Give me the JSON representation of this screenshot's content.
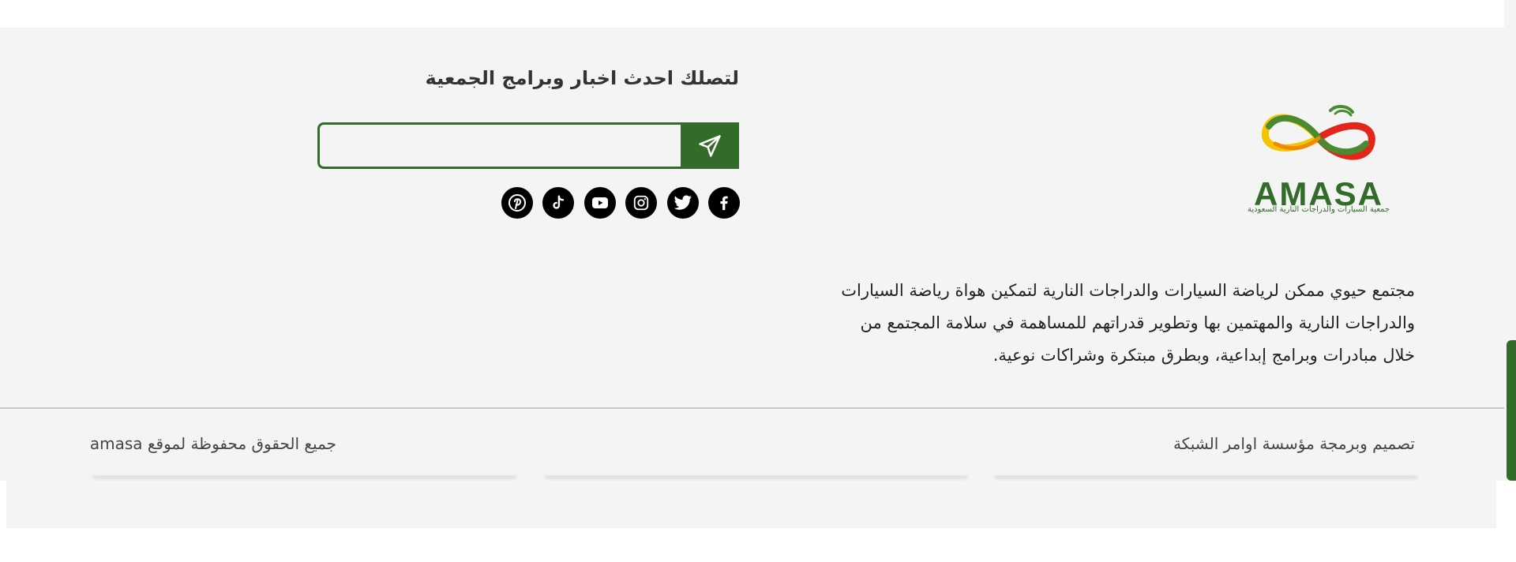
{
  "newsletter": {
    "title": "لتصلك احدث اخبار وبرامج الجمعية",
    "input_value": "",
    "send_icon": "paper-plane-icon"
  },
  "social_links": [
    {
      "name": "facebook",
      "icon": "facebook-icon"
    },
    {
      "name": "twitter",
      "icon": "twitter-icon"
    },
    {
      "name": "instagram",
      "icon": "instagram-icon"
    },
    {
      "name": "youtube",
      "icon": "youtube-icon"
    },
    {
      "name": "tiktok",
      "icon": "tiktok-icon"
    },
    {
      "name": "pinterest",
      "icon": "pinterest-icon"
    }
  ],
  "brand": {
    "logo_text": "AMASA",
    "logo_subtitle": "جمعية السيارات والدراجات النارية السعودية",
    "primary_color": "#336b2b"
  },
  "about": {
    "lines": [
      "مجتمع حيوي ممكن لرياضة السيارات والدراجات النارية لتمكين هواة رياضة السيارات",
      "والدراجات النارية والمهتمين بها وتطوير قدراتهم للمساهمة في سلامة المجتمع من",
      "خلال مبادرات وبرامج إبداعية، وبطرق مبتكرة وشراكات نوعية."
    ]
  },
  "bottom_bar": {
    "credit": "تصميم وبرمجة مؤسسة اوامر الشبكة",
    "copyright": "جميع الحقوق محفوظة لموقع amasa"
  }
}
